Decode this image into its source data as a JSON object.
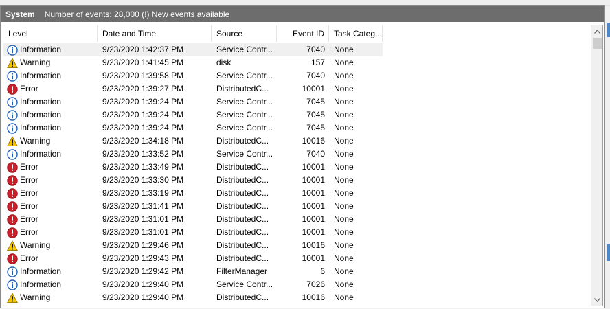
{
  "panel": {
    "title": "System",
    "status": "Number of events: 28,000 (!) New events available"
  },
  "columns": {
    "level": "Level",
    "date": "Date and Time",
    "source": "Source",
    "event_id": "Event ID",
    "task": "Task Categ..."
  },
  "icons": {
    "info": "info-icon",
    "warning": "warning-icon",
    "error": "error-icon",
    "scroll_up": "chevron-up-icon",
    "scroll_down": "chevron-down-icon"
  },
  "colors": {
    "info": "#1f5fb4",
    "warning": "#f5c400",
    "error": "#c8202a",
    "titlebar": "#6d6d6d"
  },
  "rows": [
    {
      "level": "Information",
      "type": "info",
      "date": "9/23/2020 1:42:37 PM",
      "source": "Service Contr...",
      "id": "7040",
      "task": "None"
    },
    {
      "level": "Warning",
      "type": "warning",
      "date": "9/23/2020 1:41:45 PM",
      "source": "disk",
      "id": "157",
      "task": "None"
    },
    {
      "level": "Information",
      "type": "info",
      "date": "9/23/2020 1:39:58 PM",
      "source": "Service Contr...",
      "id": "7040",
      "task": "None"
    },
    {
      "level": "Error",
      "type": "error",
      "date": "9/23/2020 1:39:27 PM",
      "source": "DistributedC...",
      "id": "10001",
      "task": "None"
    },
    {
      "level": "Information",
      "type": "info",
      "date": "9/23/2020 1:39:24 PM",
      "source": "Service Contr...",
      "id": "7045",
      "task": "None"
    },
    {
      "level": "Information",
      "type": "info",
      "date": "9/23/2020 1:39:24 PM",
      "source": "Service Contr...",
      "id": "7045",
      "task": "None"
    },
    {
      "level": "Information",
      "type": "info",
      "date": "9/23/2020 1:39:24 PM",
      "source": "Service Contr...",
      "id": "7045",
      "task": "None"
    },
    {
      "level": "Warning",
      "type": "warning",
      "date": "9/23/2020 1:34:18 PM",
      "source": "DistributedC...",
      "id": "10016",
      "task": "None"
    },
    {
      "level": "Information",
      "type": "info",
      "date": "9/23/2020 1:33:52 PM",
      "source": "Service Contr...",
      "id": "7040",
      "task": "None"
    },
    {
      "level": "Error",
      "type": "error",
      "date": "9/23/2020 1:33:49 PM",
      "source": "DistributedC...",
      "id": "10001",
      "task": "None"
    },
    {
      "level": "Error",
      "type": "error",
      "date": "9/23/2020 1:33:30 PM",
      "source": "DistributedC...",
      "id": "10001",
      "task": "None"
    },
    {
      "level": "Error",
      "type": "error",
      "date": "9/23/2020 1:33:19 PM",
      "source": "DistributedC...",
      "id": "10001",
      "task": "None"
    },
    {
      "level": "Error",
      "type": "error",
      "date": "9/23/2020 1:31:41 PM",
      "source": "DistributedC...",
      "id": "10001",
      "task": "None"
    },
    {
      "level": "Error",
      "type": "error",
      "date": "9/23/2020 1:31:01 PM",
      "source": "DistributedC...",
      "id": "10001",
      "task": "None"
    },
    {
      "level": "Error",
      "type": "error",
      "date": "9/23/2020 1:31:01 PM",
      "source": "DistributedC...",
      "id": "10001",
      "task": "None"
    },
    {
      "level": "Warning",
      "type": "warning",
      "date": "9/23/2020 1:29:46 PM",
      "source": "DistributedC...",
      "id": "10016",
      "task": "None"
    },
    {
      "level": "Error",
      "type": "error",
      "date": "9/23/2020 1:29:43 PM",
      "source": "DistributedC...",
      "id": "10001",
      "task": "None"
    },
    {
      "level": "Information",
      "type": "info",
      "date": "9/23/2020 1:29:42 PM",
      "source": "FilterManager",
      "id": "6",
      "task": "None"
    },
    {
      "level": "Information",
      "type": "info",
      "date": "9/23/2020 1:29:40 PM",
      "source": "Service Contr...",
      "id": "7026",
      "task": "None"
    },
    {
      "level": "Warning",
      "type": "warning",
      "date": "9/23/2020 1:29:40 PM",
      "source": "DistributedC...",
      "id": "10016",
      "task": "None"
    }
  ]
}
